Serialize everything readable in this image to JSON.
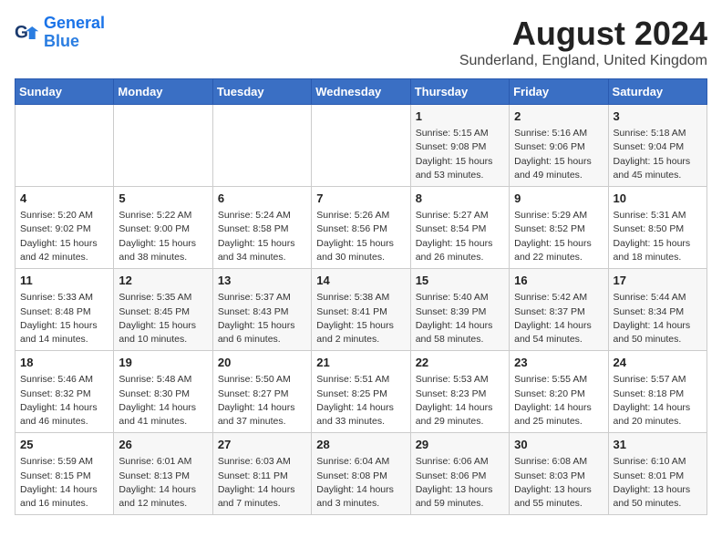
{
  "logo": {
    "line1": "General",
    "line2": "Blue"
  },
  "title": {
    "month_year": "August 2024",
    "location": "Sunderland, England, United Kingdom"
  },
  "weekdays": [
    "Sunday",
    "Monday",
    "Tuesday",
    "Wednesday",
    "Thursday",
    "Friday",
    "Saturday"
  ],
  "weeks": [
    [
      {
        "day": "",
        "info": ""
      },
      {
        "day": "",
        "info": ""
      },
      {
        "day": "",
        "info": ""
      },
      {
        "day": "",
        "info": ""
      },
      {
        "day": "1",
        "info": "Sunrise: 5:15 AM\nSunset: 9:08 PM\nDaylight: 15 hours\nand 53 minutes."
      },
      {
        "day": "2",
        "info": "Sunrise: 5:16 AM\nSunset: 9:06 PM\nDaylight: 15 hours\nand 49 minutes."
      },
      {
        "day": "3",
        "info": "Sunrise: 5:18 AM\nSunset: 9:04 PM\nDaylight: 15 hours\nand 45 minutes."
      }
    ],
    [
      {
        "day": "4",
        "info": "Sunrise: 5:20 AM\nSunset: 9:02 PM\nDaylight: 15 hours\nand 42 minutes."
      },
      {
        "day": "5",
        "info": "Sunrise: 5:22 AM\nSunset: 9:00 PM\nDaylight: 15 hours\nand 38 minutes."
      },
      {
        "day": "6",
        "info": "Sunrise: 5:24 AM\nSunset: 8:58 PM\nDaylight: 15 hours\nand 34 minutes."
      },
      {
        "day": "7",
        "info": "Sunrise: 5:26 AM\nSunset: 8:56 PM\nDaylight: 15 hours\nand 30 minutes."
      },
      {
        "day": "8",
        "info": "Sunrise: 5:27 AM\nSunset: 8:54 PM\nDaylight: 15 hours\nand 26 minutes."
      },
      {
        "day": "9",
        "info": "Sunrise: 5:29 AM\nSunset: 8:52 PM\nDaylight: 15 hours\nand 22 minutes."
      },
      {
        "day": "10",
        "info": "Sunrise: 5:31 AM\nSunset: 8:50 PM\nDaylight: 15 hours\nand 18 minutes."
      }
    ],
    [
      {
        "day": "11",
        "info": "Sunrise: 5:33 AM\nSunset: 8:48 PM\nDaylight: 15 hours\nand 14 minutes."
      },
      {
        "day": "12",
        "info": "Sunrise: 5:35 AM\nSunset: 8:45 PM\nDaylight: 15 hours\nand 10 minutes."
      },
      {
        "day": "13",
        "info": "Sunrise: 5:37 AM\nSunset: 8:43 PM\nDaylight: 15 hours\nand 6 minutes."
      },
      {
        "day": "14",
        "info": "Sunrise: 5:38 AM\nSunset: 8:41 PM\nDaylight: 15 hours\nand 2 minutes."
      },
      {
        "day": "15",
        "info": "Sunrise: 5:40 AM\nSunset: 8:39 PM\nDaylight: 14 hours\nand 58 minutes."
      },
      {
        "day": "16",
        "info": "Sunrise: 5:42 AM\nSunset: 8:37 PM\nDaylight: 14 hours\nand 54 minutes."
      },
      {
        "day": "17",
        "info": "Sunrise: 5:44 AM\nSunset: 8:34 PM\nDaylight: 14 hours\nand 50 minutes."
      }
    ],
    [
      {
        "day": "18",
        "info": "Sunrise: 5:46 AM\nSunset: 8:32 PM\nDaylight: 14 hours\nand 46 minutes."
      },
      {
        "day": "19",
        "info": "Sunrise: 5:48 AM\nSunset: 8:30 PM\nDaylight: 14 hours\nand 41 minutes."
      },
      {
        "day": "20",
        "info": "Sunrise: 5:50 AM\nSunset: 8:27 PM\nDaylight: 14 hours\nand 37 minutes."
      },
      {
        "day": "21",
        "info": "Sunrise: 5:51 AM\nSunset: 8:25 PM\nDaylight: 14 hours\nand 33 minutes."
      },
      {
        "day": "22",
        "info": "Sunrise: 5:53 AM\nSunset: 8:23 PM\nDaylight: 14 hours\nand 29 minutes."
      },
      {
        "day": "23",
        "info": "Sunrise: 5:55 AM\nSunset: 8:20 PM\nDaylight: 14 hours\nand 25 minutes."
      },
      {
        "day": "24",
        "info": "Sunrise: 5:57 AM\nSunset: 8:18 PM\nDaylight: 14 hours\nand 20 minutes."
      }
    ],
    [
      {
        "day": "25",
        "info": "Sunrise: 5:59 AM\nSunset: 8:15 PM\nDaylight: 14 hours\nand 16 minutes."
      },
      {
        "day": "26",
        "info": "Sunrise: 6:01 AM\nSunset: 8:13 PM\nDaylight: 14 hours\nand 12 minutes."
      },
      {
        "day": "27",
        "info": "Sunrise: 6:03 AM\nSunset: 8:11 PM\nDaylight: 14 hours\nand 7 minutes."
      },
      {
        "day": "28",
        "info": "Sunrise: 6:04 AM\nSunset: 8:08 PM\nDaylight: 14 hours\nand 3 minutes."
      },
      {
        "day": "29",
        "info": "Sunrise: 6:06 AM\nSunset: 8:06 PM\nDaylight: 13 hours\nand 59 minutes."
      },
      {
        "day": "30",
        "info": "Sunrise: 6:08 AM\nSunset: 8:03 PM\nDaylight: 13 hours\nand 55 minutes."
      },
      {
        "day": "31",
        "info": "Sunrise: 6:10 AM\nSunset: 8:01 PM\nDaylight: 13 hours\nand 50 minutes."
      }
    ]
  ]
}
